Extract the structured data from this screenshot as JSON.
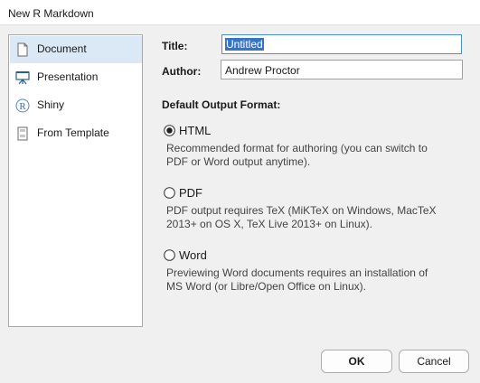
{
  "window": {
    "title": "New R Markdown"
  },
  "sidebar": {
    "items": [
      {
        "label": "Document",
        "icon": "document-icon",
        "selected": true
      },
      {
        "label": "Presentation",
        "icon": "presentation-icon",
        "selected": false
      },
      {
        "label": "Shiny",
        "icon": "shiny-r-icon",
        "selected": false
      },
      {
        "label": "From Template",
        "icon": "template-icon",
        "selected": false
      }
    ]
  },
  "form": {
    "title_label": "Title:",
    "title_value": "Untitled",
    "author_label": "Author:",
    "author_value": "Andrew Proctor"
  },
  "output": {
    "heading": "Default Output Format:",
    "options": [
      {
        "label": "HTML",
        "selected": true,
        "description": "Recommended format for authoring (you can switch to PDF or Word output anytime)."
      },
      {
        "label": "PDF",
        "selected": false,
        "description": "PDF output requires TeX (MiKTeX on Windows, MacTeX 2013+ on OS X, TeX Live 2013+ on Linux)."
      },
      {
        "label": "Word",
        "selected": false,
        "description": "Previewing Word documents requires an installation of MS Word (or Libre/Open Office on Linux)."
      }
    ]
  },
  "buttons": {
    "ok": "OK",
    "cancel": "Cancel"
  },
  "colors": {
    "selection": "#dbe9f7",
    "text_selection": "#3874c6",
    "focus_border": "#4a90d9"
  }
}
